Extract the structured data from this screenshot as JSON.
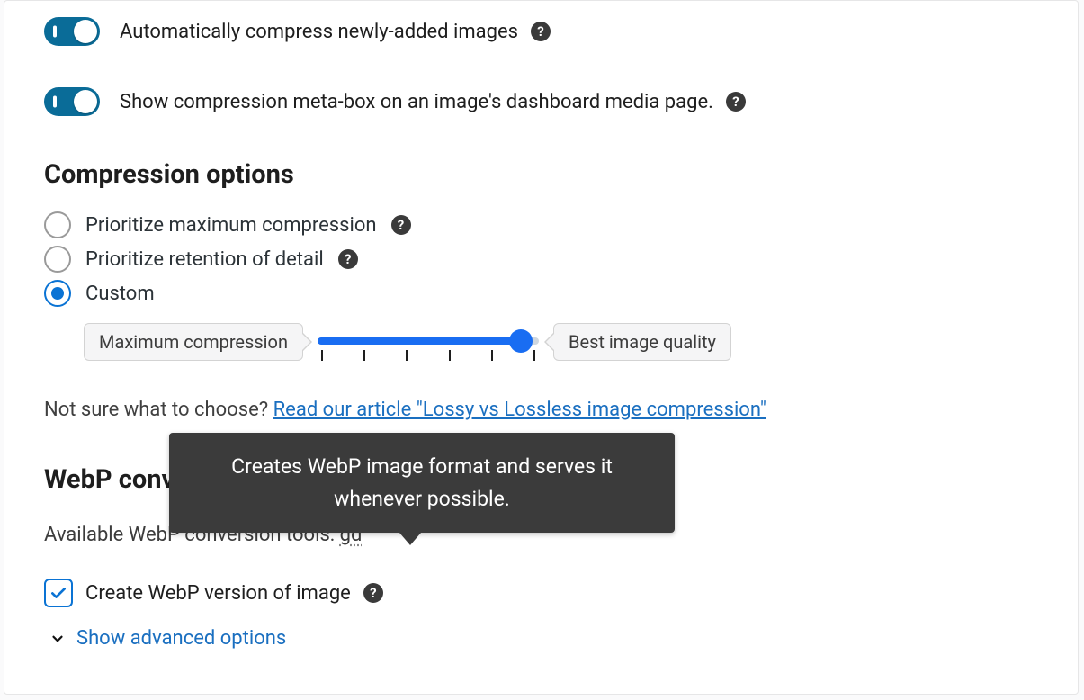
{
  "toggles": {
    "auto_compress": {
      "label": "Automatically compress newly-added images",
      "on": true
    },
    "meta_box": {
      "label": "Show compression meta-box on an image's dashboard media page.",
      "on": true
    }
  },
  "compression": {
    "heading": "Compression options",
    "options": [
      {
        "label": "Prioritize maximum compression",
        "help": true,
        "selected": false
      },
      {
        "label": "Prioritize retention of detail",
        "help": true,
        "selected": false
      },
      {
        "label": "Custom",
        "help": false,
        "selected": true
      }
    ],
    "slider": {
      "min_label": "Maximum compression",
      "max_label": "Best image quality",
      "ticks": 6,
      "value_pct": 92
    },
    "hint_prefix": "Not sure what to choose? ",
    "hint_link": "Read our article \"Lossy vs Lossless image compression\""
  },
  "webp": {
    "heading": "WebP conversion",
    "tools_prefix": "Available WebP conversion tools: ",
    "tools_value": "gd",
    "create_label": "Create WebP version of image",
    "create_checked": true,
    "show_advanced": "Show advanced options",
    "tooltip": "Creates WebP image format and serves it whenever possible."
  }
}
